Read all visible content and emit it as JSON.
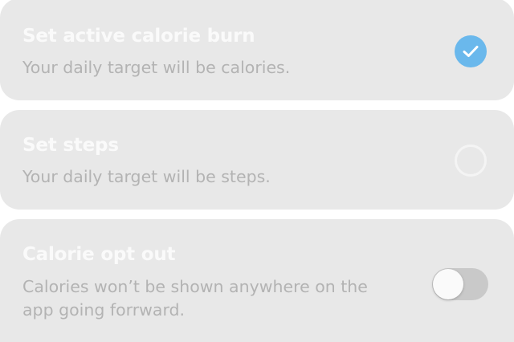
{
  "options": [
    {
      "title": "Set active calorie burn",
      "description": "Your daily target will be calories.",
      "control": "radio",
      "selected": true
    },
    {
      "title": "Set steps",
      "description": "Your daily target will be steps.",
      "control": "radio",
      "selected": false
    },
    {
      "title": "Calorie opt out",
      "description_line1": "Calories won’t be shown anywhere on the",
      "description_line2": "app going forrward.",
      "control": "toggle",
      "on": false
    }
  ],
  "colors": {
    "card_background": "#e8e8e8",
    "accent_check": "#6ab8ec",
    "title_text": "#fafafa",
    "description_text": "#b3b3b3",
    "toggle_track_off": "#c9c9c9"
  },
  "icons": {
    "selected_radio": "checkmark-icon"
  }
}
